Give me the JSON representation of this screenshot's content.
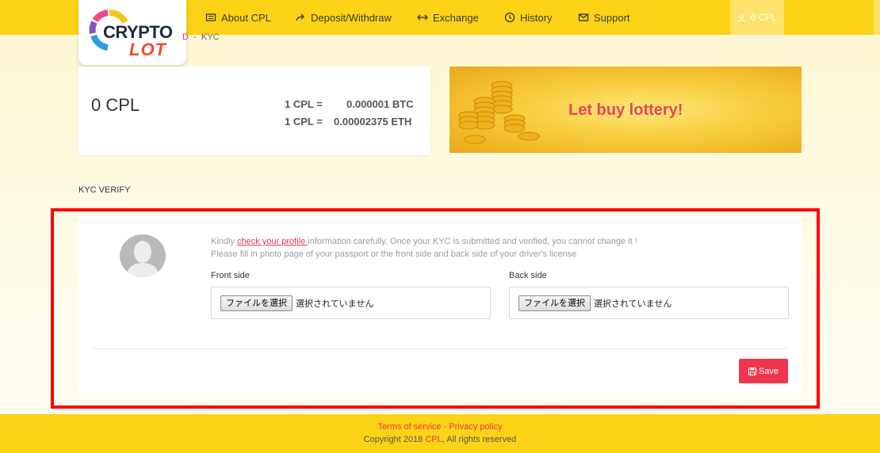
{
  "brand": {
    "logo_top": "CRYPTO",
    "logo_bottom": "LOT"
  },
  "nav": [
    {
      "label": "About CPL",
      "icon": "chip-icon"
    },
    {
      "label": "Deposit/Withdraw",
      "icon": "share-arrow-icon"
    },
    {
      "label": "Exchange",
      "icon": "exchange-arrows-icon"
    },
    {
      "label": "History",
      "icon": "clock-history-icon"
    },
    {
      "label": "Support",
      "icon": "envelope-icon"
    }
  ],
  "account": {
    "balance_label": "0 CPL",
    "icon": "user-icon"
  },
  "breadcrumb": {
    "parent": "D",
    "separator": "-",
    "current": "KYC"
  },
  "balance": {
    "amount": "0 CPL",
    "rates": [
      {
        "unit": "1 CPL =",
        "value": "0.000001 BTC"
      },
      {
        "unit": "1 CPL =",
        "value": "0.00002375 ETH"
      }
    ]
  },
  "banner": {
    "text": "Let buy lottery!"
  },
  "kyc": {
    "section_title": "KYC VERIFY",
    "notice_prefix": "Kindly ",
    "notice_link": "check your profile ",
    "notice_suffix": "information carefully. Once your KYC is submitted and verified, you cannot change it !",
    "notice_line2": "Please fill in photo page of your passport or the front side and back side of your driver's license",
    "front": {
      "label": "Front side",
      "button": "ファイルを選択",
      "status": "選択されていません"
    },
    "back": {
      "label": "Back side",
      "button": "ファイルを選択",
      "status": "選択されていません"
    },
    "save_label": "Save"
  },
  "footer": {
    "terms": "Terms of service",
    "separator": " - ",
    "privacy": "Privacy policy",
    "copyright_prefix": "Copyright 2018 ",
    "copyright_brand": "CPL",
    "copyright_suffix": ", All rights reserved"
  },
  "colors": {
    "header_yellow": "#fcd316",
    "accent_red": "#f2354f",
    "link_red": "#e8374a",
    "highlight_red": "#ff0000"
  }
}
